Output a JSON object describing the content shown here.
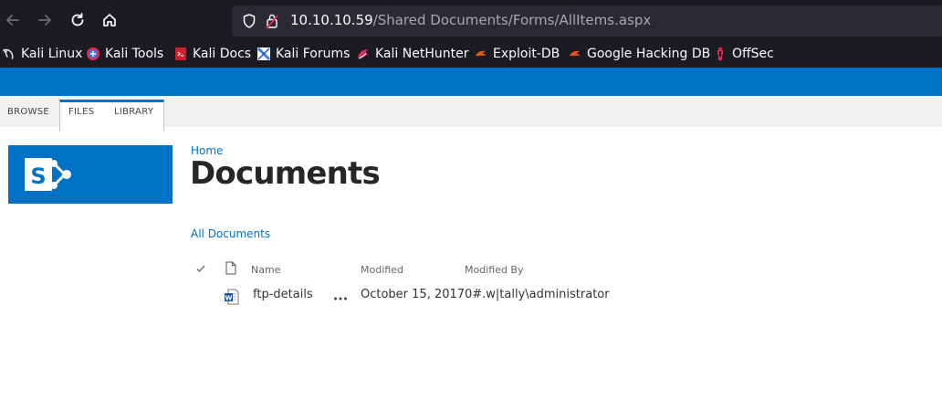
{
  "browser": {
    "url_host": "10.10.10.59",
    "url_path": "/Shared Documents/Forms/AllItems.aspx",
    "bookmarks": [
      {
        "label": "Kali Linux",
        "icon": "kali-dragon-icon"
      },
      {
        "label": "Kali Tools",
        "icon": "kali-tools-icon"
      },
      {
        "label": "Kali Docs",
        "icon": "kali-docs-icon"
      },
      {
        "label": "Kali Forums",
        "icon": "kali-forums-icon"
      },
      {
        "label": "Kali NetHunter",
        "icon": "kali-nethunter-icon"
      },
      {
        "label": "Exploit-DB",
        "icon": "exploit-db-icon"
      },
      {
        "label": "Google Hacking DB",
        "icon": "ghdb-icon"
      },
      {
        "label": "OffSec",
        "icon": "offsec-icon"
      }
    ]
  },
  "ribbon": {
    "tabs": [
      "BROWSE",
      "FILES",
      "LIBRARY"
    ]
  },
  "page": {
    "breadcrumb": "Home",
    "title": "Documents",
    "view": "All Documents"
  },
  "list": {
    "columns": {
      "name": "Name",
      "modified": "Modified",
      "modified_by": "Modified By"
    },
    "rows": [
      {
        "name": "ftp-details",
        "modified": "October 15, 2017",
        "modified_by": "0#.w|tally\\administrator",
        "icon": "word-doc-icon"
      }
    ]
  },
  "colors": {
    "suite_blue": "#0072c6",
    "chrome_dark": "#1c1b22",
    "urlbar": "#2b2a33"
  }
}
